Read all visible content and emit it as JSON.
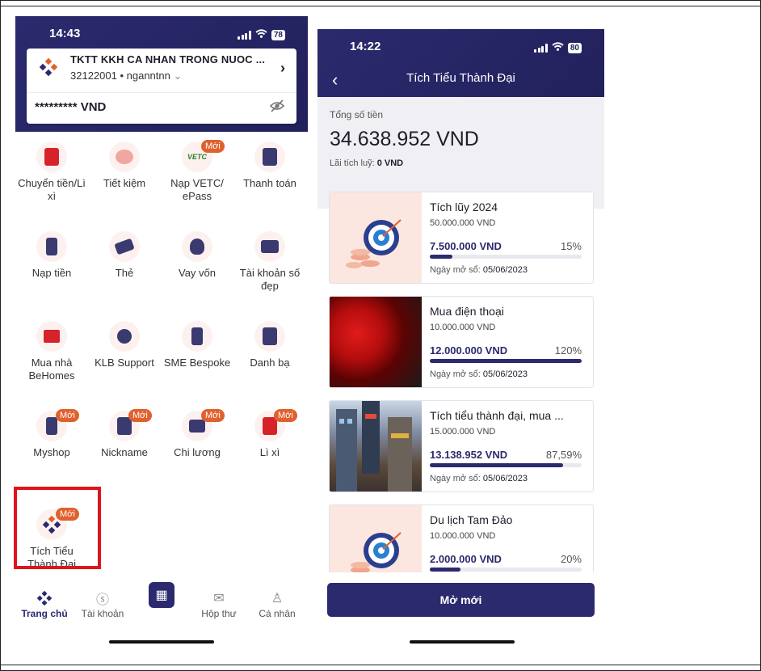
{
  "left_phone": {
    "status_time": "14:43",
    "battery": "78",
    "account": {
      "name": "TKTT KKH CA NHAN TRONG NUOC ...",
      "number": "32122001",
      "holder": "nganntnn",
      "balance": "********* VND"
    },
    "tiles": [
      {
        "label": "Chuyển tiền/Lì xì",
        "badge": ""
      },
      {
        "label": "Tiết kiệm",
        "badge": ""
      },
      {
        "label": "Nạp VETC/ ePass",
        "badge": "Mới",
        "icon_text": "VETC"
      },
      {
        "label": "Thanh toán",
        "badge": ""
      },
      {
        "label": "Nạp tiền",
        "badge": ""
      },
      {
        "label": "Thẻ",
        "badge": ""
      },
      {
        "label": "Vay vốn",
        "badge": ""
      },
      {
        "label": "Tài khoản số đẹp",
        "badge": ""
      },
      {
        "label": "Mua nhà BeHomes",
        "badge": ""
      },
      {
        "label": "KLB Support",
        "badge": ""
      },
      {
        "label": "SME Bespoke",
        "badge": ""
      },
      {
        "label": "Danh bạ",
        "badge": ""
      },
      {
        "label": "Myshop",
        "badge": "Mới"
      },
      {
        "label": "Nickname",
        "badge": "Mới"
      },
      {
        "label": "Chi lương",
        "badge": "Mới"
      },
      {
        "label": "Lì xì",
        "badge": "Mới"
      },
      {
        "label": "Tích Tiểu Thành Đại",
        "badge": "Mới"
      }
    ],
    "tabs": [
      {
        "label": "Trang chủ"
      },
      {
        "label": "Tài khoản"
      },
      {
        "label": ""
      },
      {
        "label": "Hộp thư"
      },
      {
        "label": "Cá nhân"
      }
    ]
  },
  "right_phone": {
    "status_time": "14:22",
    "battery": "80",
    "title": "Tích Tiểu Thành Đại",
    "summary": {
      "label": "Tổng số tiền",
      "amount": "34.638.952 VND",
      "interest_label": "Lãi tích luỹ:",
      "interest_value": "0 VND"
    },
    "date_label": "Ngày mở sổ:",
    "goals": [
      {
        "name": "Tích lũy 2024",
        "target": "50.000.000 VND",
        "saved": "7.500.000 VND",
        "percent_text": "15%",
        "progress": 0.15,
        "date": "05/06/2023"
      },
      {
        "name": "Mua điện thoại",
        "target": "10.000.000 VND",
        "saved": "12.000.000 VND",
        "percent_text": "120%",
        "progress": 1.0,
        "date": "05/06/2023"
      },
      {
        "name": "Tích tiểu thành đại, mua ...",
        "target": "15.000.000 VND",
        "saved": "13.138.952 VND",
        "percent_text": "87,59%",
        "progress": 0.8759,
        "date": "05/06/2023"
      },
      {
        "name": "Du lịch Tam Đảo",
        "target": "10.000.000 VND",
        "saved": "2.000.000 VND",
        "percent_text": "20%",
        "progress": 0.2,
        "date": ""
      }
    ],
    "button_label": "Mở mới"
  },
  "colors": {
    "brand": "#2b2a6e",
    "badge": "#e0602e",
    "highlight": "#e0141c"
  }
}
